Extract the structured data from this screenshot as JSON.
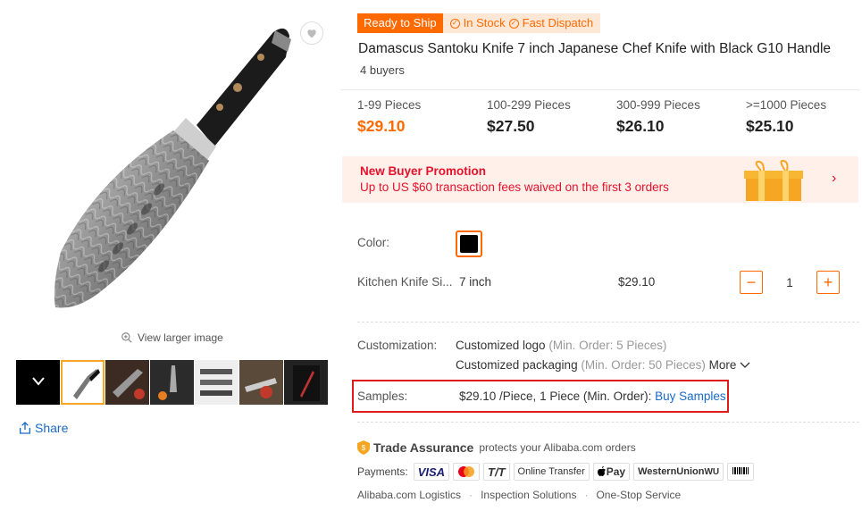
{
  "gallery": {
    "view_larger": "View larger image",
    "share": "Share"
  },
  "badges": {
    "ready": "Ready to Ship",
    "in_stock": "In Stock",
    "fast_dispatch": "Fast Dispatch"
  },
  "product": {
    "title": "Damascus Santoku Knife 7 inch Japanese Chef Knife with Black G10 Handle",
    "buyers": "4 buyers"
  },
  "tiers": [
    {
      "qty": "1-99 Pieces",
      "price": "$29.10"
    },
    {
      "qty": "100-299 Pieces",
      "price": "$27.50"
    },
    {
      "qty": ">=1000 Pieces",
      "price": "$25.10"
    },
    {
      "qty": "300-999 Pieces",
      "price": "$26.10"
    }
  ],
  "promo": {
    "title": "New Buyer Promotion",
    "text": "Up to US $60 transaction fees waived on the first 3 orders"
  },
  "options": {
    "color_label": "Color:",
    "swatch_color": "#000000",
    "size_label": "Kitchen Knife Si...",
    "size_value": "7 inch",
    "size_price": "$29.10",
    "quantity": "1",
    "minus": "−",
    "plus": "+"
  },
  "customization": {
    "label": "Customization:",
    "logo": "Customized logo",
    "logo_min": "(Min. Order: 5 Pieces)",
    "packaging": "Customized packaging",
    "packaging_min": "(Min. Order: 50 Pieces)",
    "more": "More"
  },
  "samples": {
    "label": "Samples:",
    "value": "$29.10 /Piece, 1 Piece (Min. Order):",
    "link": "Buy Samples"
  },
  "trade": {
    "title": "Trade Assurance",
    "subtitle": "protects your Alibaba.com orders",
    "payments_label": "Payments:",
    "methods": [
      "VISA",
      "T/T",
      "Online Transfer",
      "Pay",
      "WesternUnion",
      "WU"
    ],
    "services": [
      "Alibaba.com Logistics",
      "Inspection Solutions",
      "One-Stop Service"
    ]
  },
  "colors": {
    "accent": "#ff6a00",
    "promo_red": "#e6122d",
    "link_blue": "#1a6bc9",
    "highlight_box": "#e01b1b"
  }
}
